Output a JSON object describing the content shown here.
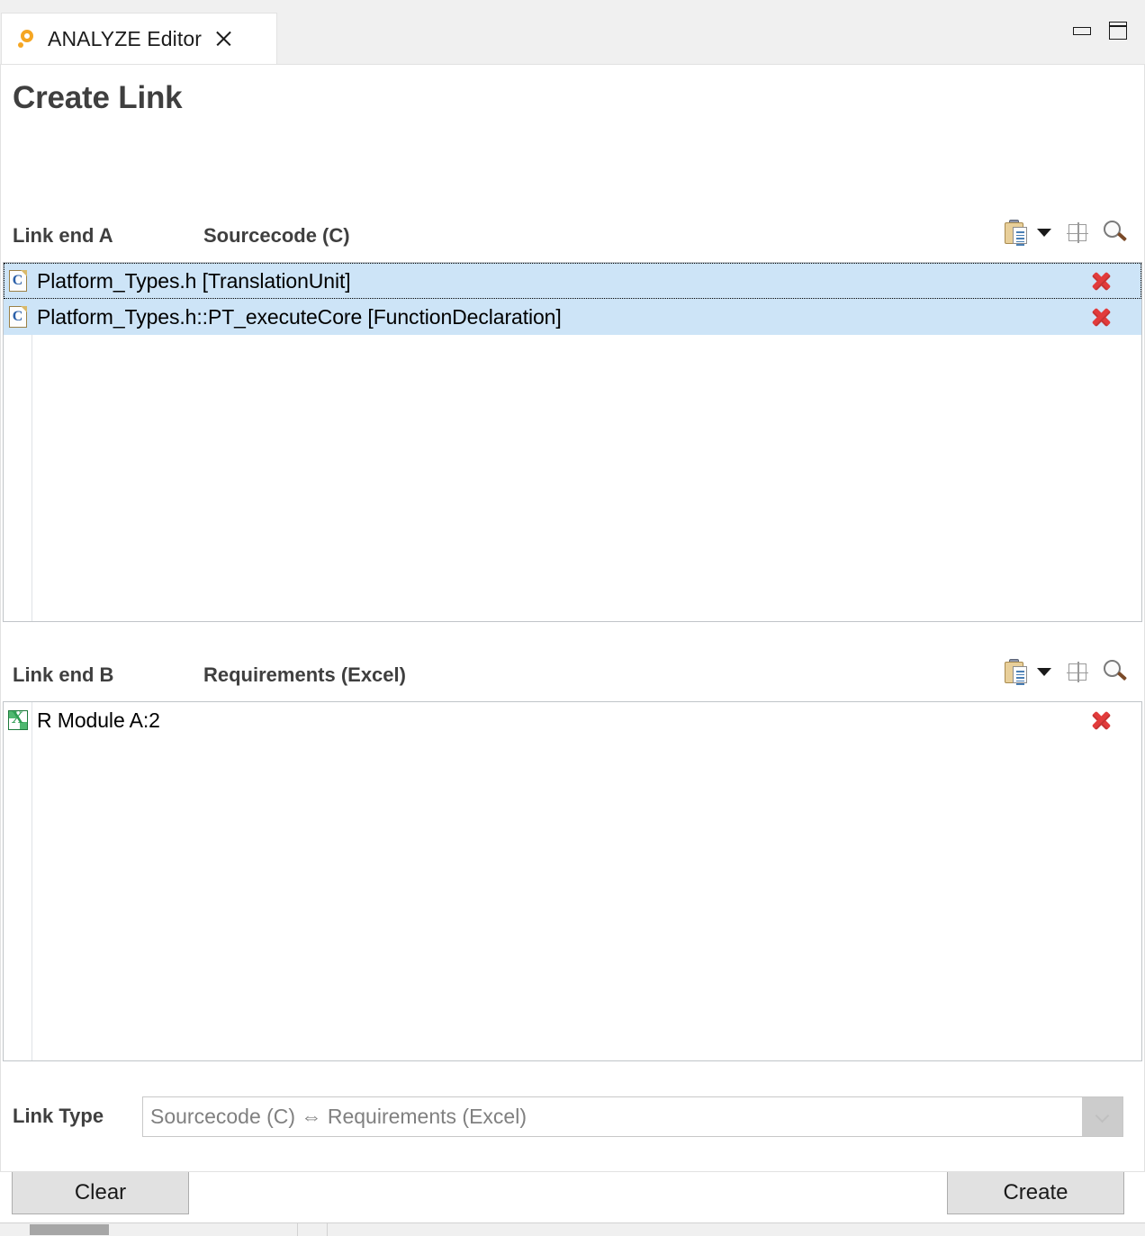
{
  "window": {
    "tab": {
      "title": "ANALYZE Editor",
      "icon": "analyze-ring-icon",
      "close_icon": "close-icon"
    },
    "controls": {
      "minimize": "minimize-icon",
      "maximize": "maximize-icon"
    }
  },
  "page": {
    "title": "Create Link"
  },
  "link_end_a": {
    "label": "Link end A",
    "type_label": "Sourcecode (C)",
    "tools": {
      "paste": "clipboard-paste-icon",
      "dropdown": "caret-down-icon",
      "grid": "table-grid-icon",
      "search": "magnifier-icon"
    },
    "items": [
      {
        "label": "Platform_Types.h [TranslationUnit]",
        "icon": "c-header-file-icon",
        "selected": true,
        "focused": true,
        "delete_icon": "delete-red-x-icon"
      },
      {
        "label": "Platform_Types.h::PT_executeCore [FunctionDeclaration]",
        "icon": "c-header-file-icon",
        "selected": true,
        "focused": false,
        "delete_icon": "delete-red-x-icon"
      }
    ]
  },
  "link_end_b": {
    "label": "Link end B",
    "type_label": "Requirements (Excel)",
    "tools": {
      "paste": "clipboard-paste-icon",
      "dropdown": "caret-down-icon",
      "grid": "table-grid-icon",
      "search": "magnifier-icon"
    },
    "items": [
      {
        "label": "R Module A:2",
        "icon": "excel-file-icon",
        "selected": false,
        "focused": false,
        "delete_icon": "delete-red-x-icon"
      }
    ]
  },
  "link_type": {
    "label": "Link Type",
    "value": "Sourcecode (C) ⇔ Requirements (Excel)",
    "dropdown_icon": "chevron-down-icon"
  },
  "actions": {
    "clear_label": "Clear",
    "create_label": "Create"
  },
  "colors": {
    "selection": "#cde4f7",
    "accent_orange": "#f5a623",
    "delete_red": "#e23b3b",
    "excel_green": "#2e9c52",
    "button_face": "#e1e1e1"
  }
}
